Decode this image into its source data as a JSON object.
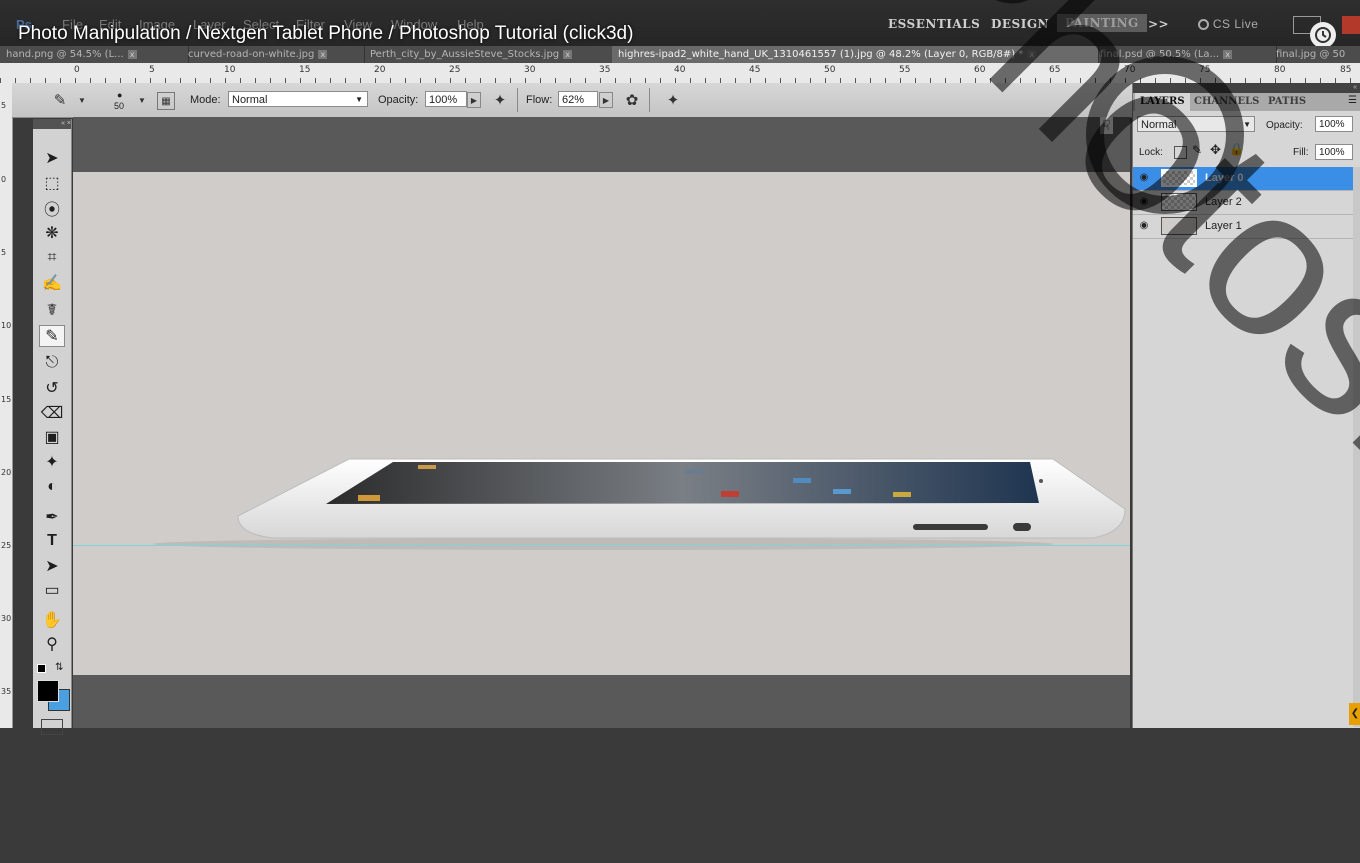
{
  "video": {
    "title": "Photo Manipulation / Nextgen Tablet Phone / Photoshop Tutorial (click3d)"
  },
  "menu": {
    "items": [
      "File",
      "Edit",
      "Image",
      "Layer",
      "Select",
      "Filter",
      "View",
      "Window",
      "Help"
    ]
  },
  "workspaces": {
    "essentials": "ESSENTIALS",
    "design": "DESIGN",
    "painting": "PAINTING",
    "more": ">>",
    "cs_live": "CS Live"
  },
  "doc_tabs": [
    {
      "label": "hand.png @ 54.5% (L...",
      "active": false
    },
    {
      "label": "curved-road-on-white.jpg",
      "active": false
    },
    {
      "label": "Perth_city_by_AussieSteve_Stocks.jpg",
      "active": false
    },
    {
      "label": "highres-ipad2_white_hand_UK_1310461557 (1).jpg @ 48.2% (Layer 0, RGB/8#) *",
      "active": true
    },
    {
      "label": "final.psd @ 50.5% (La...",
      "active": false
    },
    {
      "label": "final.jpg @ 50",
      "active": false
    }
  ],
  "ruler": {
    "h_labels": [
      "0",
      "5",
      "10",
      "15",
      "20",
      "25",
      "30",
      "35",
      "40",
      "45",
      "50",
      "55",
      "60",
      "65",
      "70",
      "75",
      "80",
      "85"
    ],
    "v_labels": [
      "5",
      "0",
      "5",
      "10",
      "15",
      "20",
      "25",
      "30",
      "35"
    ]
  },
  "options": {
    "brush_size": "50",
    "mode_label": "Mode:",
    "mode_value": "Normal",
    "opacity_label": "Opacity:",
    "opacity_value": "100%",
    "flow_label": "Flow:",
    "flow_value": "62%"
  },
  "toolbox": {
    "tools": [
      "move-tool-icon",
      "marquee-tool-icon",
      "lasso-tool-icon",
      "quick-select-tool-icon",
      "crop-tool-icon",
      "eyedropper-tool-icon",
      "healing-brush-tool-icon",
      "brush-tool-icon",
      "clone-stamp-tool-icon",
      "history-brush-tool-icon",
      "eraser-tool-icon",
      "gradient-tool-icon",
      "blur-tool-icon",
      "dodge-tool-icon",
      "pen-tool-icon",
      "type-tool-icon",
      "path-select-tool-icon",
      "shape-tool-icon",
      "hand-tool-icon",
      "zoom-tool-icon"
    ],
    "selected": "brush-tool-icon",
    "foreground": "#000000",
    "background": "#4a9fe0"
  },
  "layers_panel": {
    "tabs": [
      "LAYERS",
      "CHANNELS",
      "PATHS"
    ],
    "blend_mode": "Normal",
    "opacity_label": "Opacity:",
    "opacity_value": "100%",
    "lock_label": "Lock:",
    "fill_label": "Fill:",
    "fill_value": "100%",
    "layers": [
      {
        "name": "Layer 0",
        "selected": true
      },
      {
        "name": "Layer 2",
        "selected": false
      },
      {
        "name": "Layer 1",
        "selected": false
      }
    ]
  },
  "watermark": {
    "text": "Photoshop"
  },
  "colors": {
    "accent": "#3a8ee6",
    "canvas_bg": "#cfccc9",
    "guide": "#7fd4dc"
  }
}
